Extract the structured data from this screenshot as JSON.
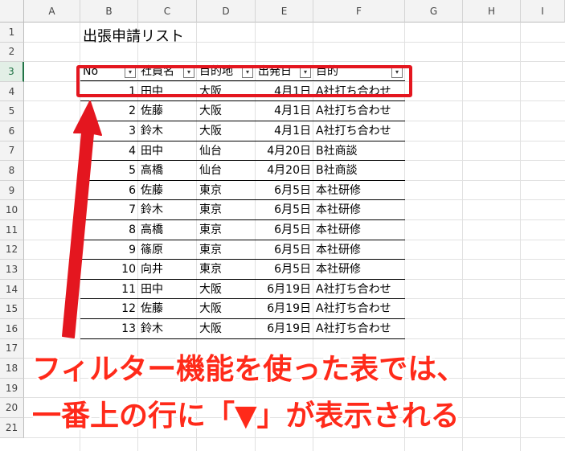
{
  "columns": [
    "A",
    "B",
    "C",
    "D",
    "E",
    "F",
    "G",
    "H",
    "I"
  ],
  "rows": [
    "1",
    "2",
    "3",
    "4",
    "5",
    "6",
    "7",
    "8",
    "9",
    "10",
    "11",
    "12",
    "13",
    "14",
    "15",
    "16",
    "17",
    "18",
    "19",
    "20",
    "21"
  ],
  "title": "出張申請リスト",
  "table": {
    "headers": [
      "No",
      "社員名",
      "目的地",
      "出発日",
      "目的"
    ],
    "rows": [
      [
        "1",
        "田中",
        "大阪",
        "4月1日",
        "A社打ち合わせ"
      ],
      [
        "2",
        "佐藤",
        "大阪",
        "4月1日",
        "A社打ち合わせ"
      ],
      [
        "3",
        "鈴木",
        "大阪",
        "4月1日",
        "A社打ち合わせ"
      ],
      [
        "4",
        "田中",
        "仙台",
        "4月20日",
        "B社商談"
      ],
      [
        "5",
        "高橋",
        "仙台",
        "4月20日",
        "B社商談"
      ],
      [
        "6",
        "佐藤",
        "東京",
        "6月5日",
        "本社研修"
      ],
      [
        "7",
        "鈴木",
        "東京",
        "6月5日",
        "本社研修"
      ],
      [
        "8",
        "高橋",
        "東京",
        "6月5日",
        "本社研修"
      ],
      [
        "9",
        "篠原",
        "東京",
        "6月5日",
        "本社研修"
      ],
      [
        "10",
        "向井",
        "東京",
        "6月5日",
        "本社研修"
      ],
      [
        "11",
        "田中",
        "大阪",
        "6月19日",
        "A社打ち合わせ"
      ],
      [
        "12",
        "佐藤",
        "大阪",
        "6月19日",
        "A社打ち合わせ"
      ],
      [
        "13",
        "鈴木",
        "大阪",
        "6月19日",
        "A社打ち合わせ"
      ]
    ]
  },
  "annotation": {
    "line1": "フィルター機能を使った表では、",
    "line2": "一番上の行に「▼」が表示される",
    "color": "#e4161f"
  },
  "filter_icon": "▾",
  "filter_active_icon": "▾"
}
